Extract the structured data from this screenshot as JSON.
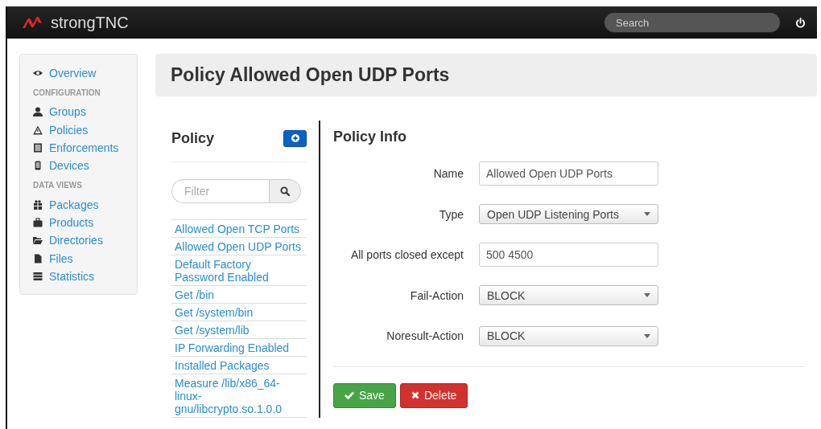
{
  "navbar": {
    "brand": "strongTNC",
    "search": {
      "placeholder": "Search"
    }
  },
  "sidebar": {
    "items": [
      {
        "kind": "link",
        "label": "Overview"
      },
      {
        "kind": "heading",
        "label": "CONFIGURATION"
      },
      {
        "kind": "link",
        "label": "Groups"
      },
      {
        "kind": "link",
        "label": "Policies"
      },
      {
        "kind": "link",
        "label": "Enforcements"
      },
      {
        "kind": "link",
        "label": "Devices"
      },
      {
        "kind": "heading",
        "label": "DATA VIEWS"
      },
      {
        "kind": "link",
        "label": "Packages"
      },
      {
        "kind": "link",
        "label": "Products"
      },
      {
        "kind": "link",
        "label": "Directories"
      },
      {
        "kind": "link",
        "label": "Files"
      },
      {
        "kind": "link",
        "label": "Statistics"
      }
    ]
  },
  "page_title": "Policy Allowed Open UDP Ports",
  "policy_list": {
    "heading": "Policy",
    "filter": {
      "placeholder": "Filter"
    },
    "items": [
      "Allowed Open TCP Ports",
      "Allowed Open UDP Ports",
      "Default Factory Password Enabled",
      "Get /bin",
      "Get /system/bin",
      "Get /system/lib",
      "IP Forwarding Enabled",
      "Installed Packages",
      "Measure /lib/x86_64-linux-gnu/libcrypto.so.1.0.0"
    ]
  },
  "policy_info": {
    "heading": "Policy Info",
    "fields": [
      {
        "kind": "input",
        "label": "Name",
        "value": "Allowed Open UDP Ports"
      },
      {
        "kind": "select",
        "label": "Type",
        "value": "Open UDP Listening Ports"
      },
      {
        "kind": "input",
        "label": "All ports closed except",
        "value": "500 4500"
      },
      {
        "kind": "select",
        "label": "Fail-Action",
        "value": "BLOCK"
      },
      {
        "kind": "select",
        "label": "Noresult-Action",
        "value": "BLOCK"
      }
    ],
    "buttons": [
      {
        "kind": "save",
        "label": "Save"
      },
      {
        "kind": "delete",
        "label": "Delete"
      }
    ]
  }
}
